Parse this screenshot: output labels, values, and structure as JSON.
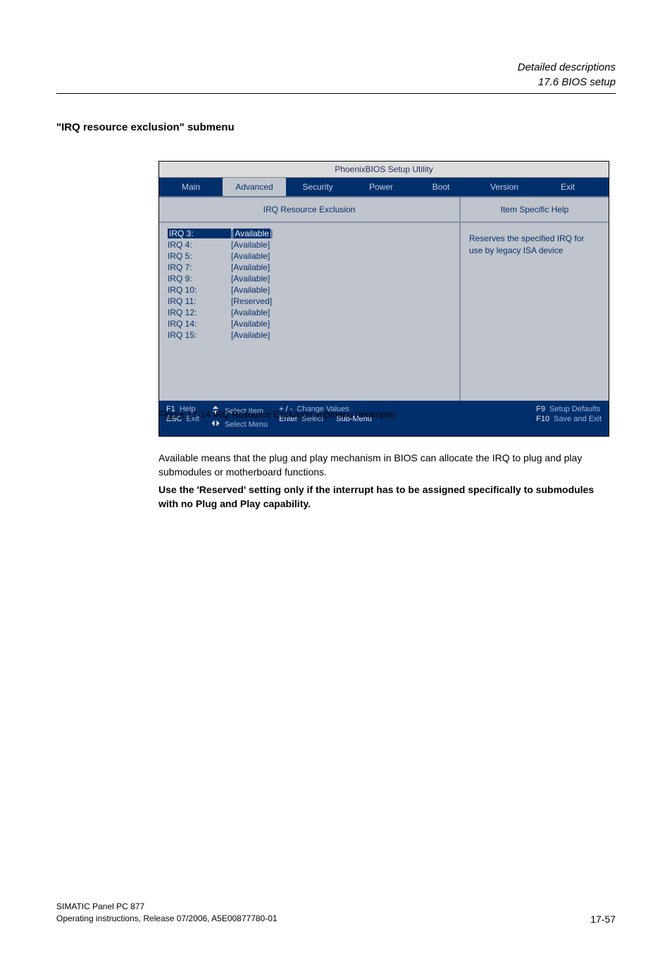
{
  "header": {
    "line1": "Detailed descriptions",
    "line2": "17.6 BIOS setup"
  },
  "section_title": "\"IRQ resource exclusion\" submenu",
  "bios": {
    "top_title": "PhoenixBIOS Setup Utility",
    "tabs": {
      "main": "Main",
      "advanced": "Advanced",
      "security": "Security",
      "power": "Power",
      "boot": "Boot",
      "version": "Version",
      "exit": "Exit"
    },
    "left_header": "IRQ Resource Exclusion",
    "right_header": "Item Specific Help",
    "help_text": "Reserves the specified IRQ for use by legacy ISA device",
    "items": [
      {
        "label": "IRQ 3:",
        "value": "Available",
        "selected": true
      },
      {
        "label": "IRQ 4:",
        "value": "[Available]"
      },
      {
        "label": "IRQ 5:",
        "value": "[Available]"
      },
      {
        "label": "IRQ 7:",
        "value": "[Available]"
      },
      {
        "label": "IRQ 9:",
        "value": "[Available]"
      },
      {
        "label": "IRQ 10:",
        "value": "[Available]"
      },
      {
        "label": "IRQ 11:",
        "value": "[Reserved]"
      },
      {
        "label": "IRQ 12:",
        "value": "[Available]"
      },
      {
        "label": "IRQ 14:",
        "value": "[Available]"
      },
      {
        "label": "IRQ 15:",
        "value": "[Available]"
      }
    ],
    "footer": {
      "f1": "F1",
      "help": "Help",
      "esc": "ESC",
      "exit": "Exit",
      "select_item": "Select Item",
      "select_menu": "Select Menu",
      "plus_minus": "+ / -",
      "change_values": "Change Values",
      "enter": "Enter",
      "select": "Select",
      "sub_menu": "Sub-Menu",
      "f9": "F9",
      "setup_defaults": "Setup Defaults",
      "f10": "F10",
      "save_and_exit": "Save and Exit"
    }
  },
  "caption": "Figure 17-14  IRQ Resource Exclusion submenu (example)",
  "body_text": "Available means that the plug and play mechanism in BIOS can allocate the IRQ to plug and play submodules or motherboard functions.",
  "body_bold": "Use the 'Reserved' setting only if the interrupt has to be assigned specifically to submodules with no Plug and Play capability.",
  "footer": {
    "line1": "SIMATIC Panel PC 877",
    "line2": "Operating instructions, Release 07/2006, A5E00877780-01",
    "page": "17-57"
  }
}
